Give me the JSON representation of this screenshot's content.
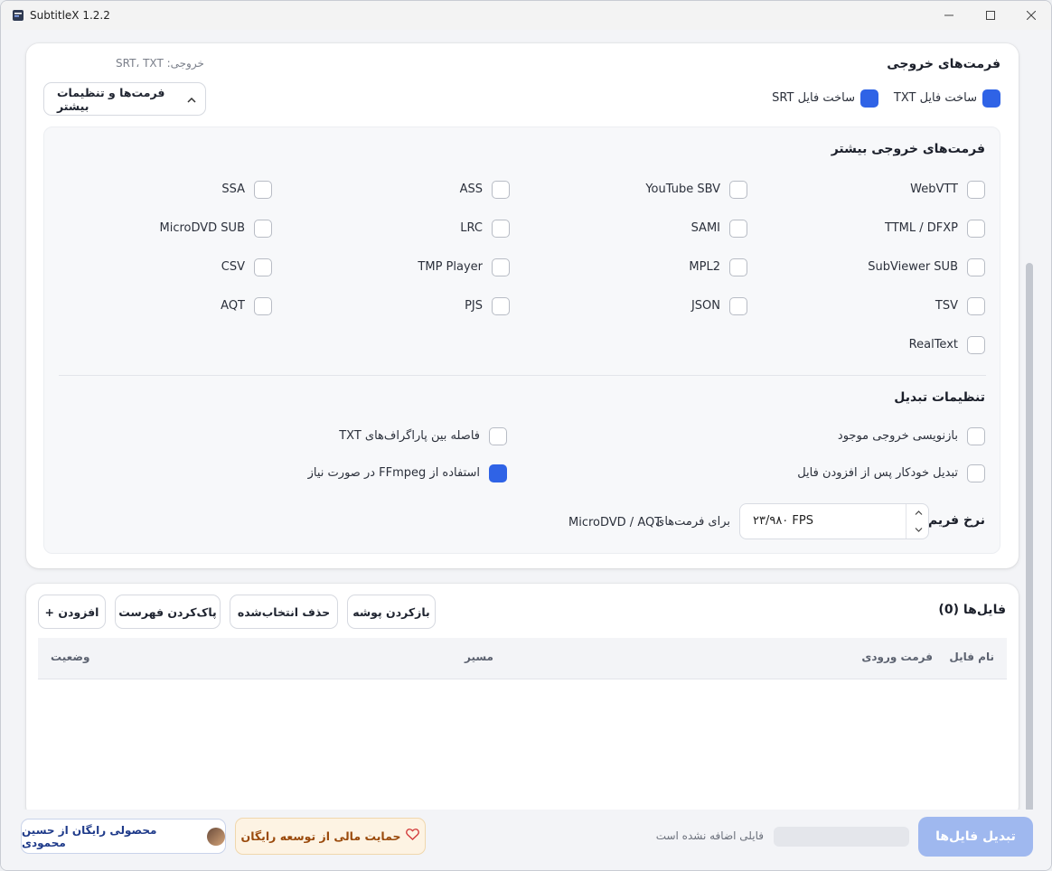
{
  "window": {
    "title": "SubtitleX 1.2.2",
    "minimize_icon": "minimize-icon",
    "maximize_icon": "maximize-icon",
    "close_icon": "close-icon"
  },
  "output": {
    "title": "فرمت‌های خروجی",
    "summary": "خروجی: SRT، TXT",
    "toggle_label": "فرمت‌ها و تنظیمات بیشتر",
    "txt_label": "ساخت فایل TXT",
    "txt_checked": true,
    "srt_label": "ساخت فایل SRT",
    "srt_checked": true
  },
  "more_formats": {
    "title": "فرمت‌های خروجی بیشتر",
    "items": [
      {
        "label": "WebVTT",
        "checked": false
      },
      {
        "label": "YouTube SBV",
        "checked": false
      },
      {
        "label": "ASS",
        "checked": false
      },
      {
        "label": "SSA",
        "checked": false
      },
      {
        "label": "TTML / DFXP",
        "checked": false
      },
      {
        "label": "SAMI",
        "checked": false
      },
      {
        "label": "LRC",
        "checked": false
      },
      {
        "label": "MicroDVD SUB",
        "checked": false
      },
      {
        "label": "SubViewer SUB",
        "checked": false
      },
      {
        "label": "MPL2",
        "checked": false
      },
      {
        "label": "TMP Player",
        "checked": false
      },
      {
        "label": "CSV",
        "checked": false
      },
      {
        "label": "TSV",
        "checked": false
      },
      {
        "label": "JSON",
        "checked": false
      },
      {
        "label": "PJS",
        "checked": false
      },
      {
        "label": "AQT",
        "checked": false
      },
      {
        "label": "RealText",
        "checked": false
      }
    ]
  },
  "conversion": {
    "title": "تنظیمات تبدیل",
    "overwrite_label": "بازنویسی خروجی موجود",
    "overwrite_checked": false,
    "para_spacing_label": "فاصله بین پاراگراف‌های TXT",
    "para_spacing_checked": false,
    "auto_convert_label": "تبدیل خودکار پس از افزودن فایل",
    "auto_convert_checked": false,
    "ffmpeg_label": "استفاده از FFmpeg در صورت نیاز",
    "ffmpeg_checked": true,
    "frame_rate_label": "نرخ فریم",
    "frame_rate_value": "۲۳/۹۸۰ FPS",
    "frame_rate_for": "برای فرمت‌های",
    "frame_rate_formats": "MicroDVD / AQT"
  },
  "files": {
    "title": "فایل‌ها (0)",
    "open_folder": "بازکردن پوشه",
    "delete_selected": "حذف انتخاب‌شده",
    "clear_list": "پاک‌کردن فهرست",
    "add": "+ افزودن",
    "columns": [
      "نام فایل",
      "فرمت ورودی",
      "مسیر",
      "وضعیت"
    ]
  },
  "footer": {
    "convert": "تبدیل فایل‌ها",
    "status": "فایلی اضافه نشده است",
    "support": "حمایت مالی از توسعه رایگان",
    "author": "محصولی رایگان از حسین محمودی"
  },
  "colors": {
    "accent": "#2f63e6",
    "convert_disabled": "#9fb8ef",
    "support_bg": "#fdf3e3",
    "support_text": "#9a4a0c"
  }
}
